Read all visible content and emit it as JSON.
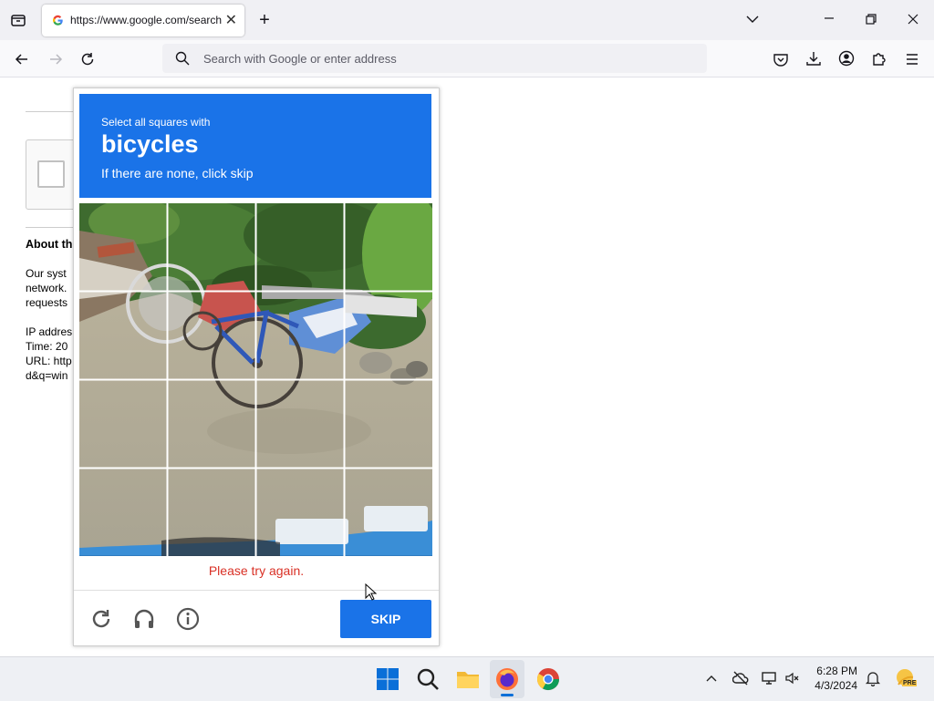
{
  "browser": {
    "tab_title": "https://www.google.com/search",
    "address_placeholder": "Search with Google or enter address"
  },
  "page": {
    "about_heading": "About th",
    "body_lines": [
      "Our syst",
      "network.",
      "requests"
    ],
    "info_lines": [
      "IP addres",
      "Time: 20",
      "URL: http",
      "d&q=win"
    ]
  },
  "captcha": {
    "instruction": "Select all squares with",
    "target": "bicycles",
    "subtext": "If there are none, click skip",
    "error": "Please try again.",
    "skip_label": "SKIP",
    "grid_rows": 4,
    "grid_cols": 4
  },
  "taskbar": {
    "time": "6:28 PM",
    "date": "4/3/2024",
    "badge": "PRE"
  },
  "colors": {
    "accent": "#1a73e8",
    "error": "#d93025"
  }
}
